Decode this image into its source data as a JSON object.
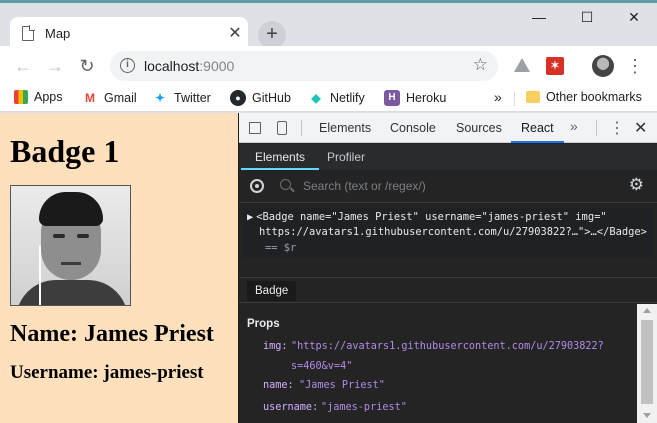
{
  "browser": {
    "tab_title": "Map",
    "tab_close": "✕",
    "new_tab": "+",
    "url_host": "localhost",
    "url_port": ":9000",
    "window_controls": [
      "—",
      "☐",
      "✕"
    ]
  },
  "bookmarks": [
    {
      "label": "Apps",
      "icon": "apps-grid-icon"
    },
    {
      "label": "Gmail",
      "icon": "gmail-icon"
    },
    {
      "label": "Twitter",
      "icon": "twitter-icon"
    },
    {
      "label": "GitHub",
      "icon": "github-icon"
    },
    {
      "label": "Netlify",
      "icon": "netlify-icon"
    },
    {
      "label": "Heroku",
      "icon": "heroku-icon"
    }
  ],
  "bookmarks_more": "»",
  "other_bookmarks": "Other bookmarks",
  "page": {
    "heading": "Badge 1",
    "name_line": "Name: James Priest",
    "username_line": "Username: james-priest"
  },
  "devtools": {
    "tabs": [
      "Elements",
      "Console",
      "Sources",
      "React"
    ],
    "active_tab": "React",
    "more": "»",
    "close": "✕"
  },
  "react": {
    "tabs": [
      "Elements",
      "Profiler"
    ],
    "active_tab": "Elements",
    "search_placeholder": "Search (text or /regex/)",
    "tree_line1": "<Badge name=\"James Priest\" username=\"james-priest\" img=\"",
    "tree_line2": "https://avatars1.githubusercontent.com/u/27903822?…\">…</Badge>",
    "tree_line3": "== $r",
    "selected_component": "Badge",
    "props_header": "Props",
    "props": [
      {
        "key": "img:",
        "value": "\"https://avatars1.githubusercontent.com/u/27903822?",
        "cont": "s=460&v=4\""
      },
      {
        "key": "name:",
        "value": "\"James Priest\""
      },
      {
        "key": "username:",
        "value": "\"james-priest\""
      }
    ]
  }
}
